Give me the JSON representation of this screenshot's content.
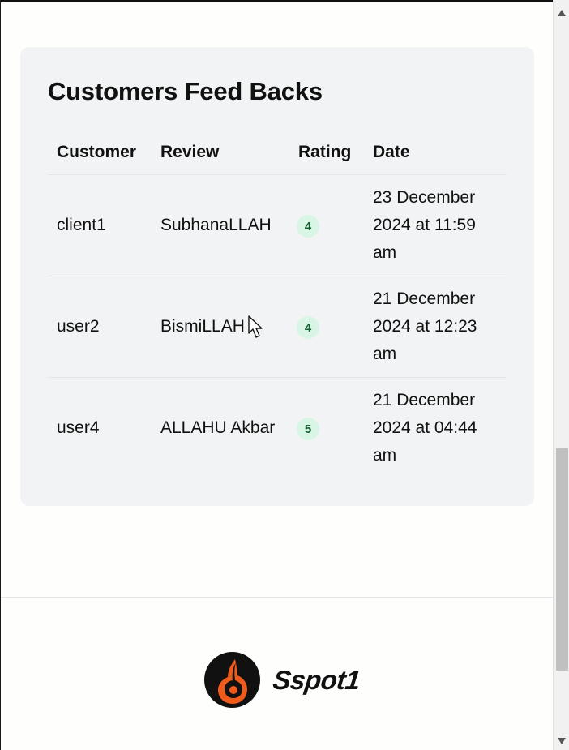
{
  "card": {
    "title": "Customers Feed Backs"
  },
  "table": {
    "headers": {
      "customer": "Customer",
      "review": "Review",
      "rating": "Rating",
      "date": "Date"
    },
    "rows": [
      {
        "customer": "client1",
        "review": "SubhanaLLAH",
        "rating": "4",
        "date": "23 December 2024 at 11:59 am"
      },
      {
        "customer": "user2",
        "review": "BismiLLAH",
        "rating": "4",
        "date": "21 December 2024 at 12:23 am"
      },
      {
        "customer": "user4",
        "review": "ALLAHU Akbar",
        "rating": "5",
        "date": "21 December 2024 at 04:44 am"
      }
    ]
  },
  "footer": {
    "brand": "Sspot1",
    "logo_icon": "orange-drop-icon"
  },
  "colors": {
    "card_background": "#f2f3f4",
    "rating_badge_background": "#d9f5e5",
    "rating_badge_text": "#145f31",
    "logo_orange": "#f05a1a",
    "logo_dark": "#111111"
  },
  "icons": {
    "cursor": "mouse-pointer-icon",
    "scroll_up": "scroll-up-arrow-icon",
    "scroll_down": "scroll-down-arrow-icon"
  }
}
